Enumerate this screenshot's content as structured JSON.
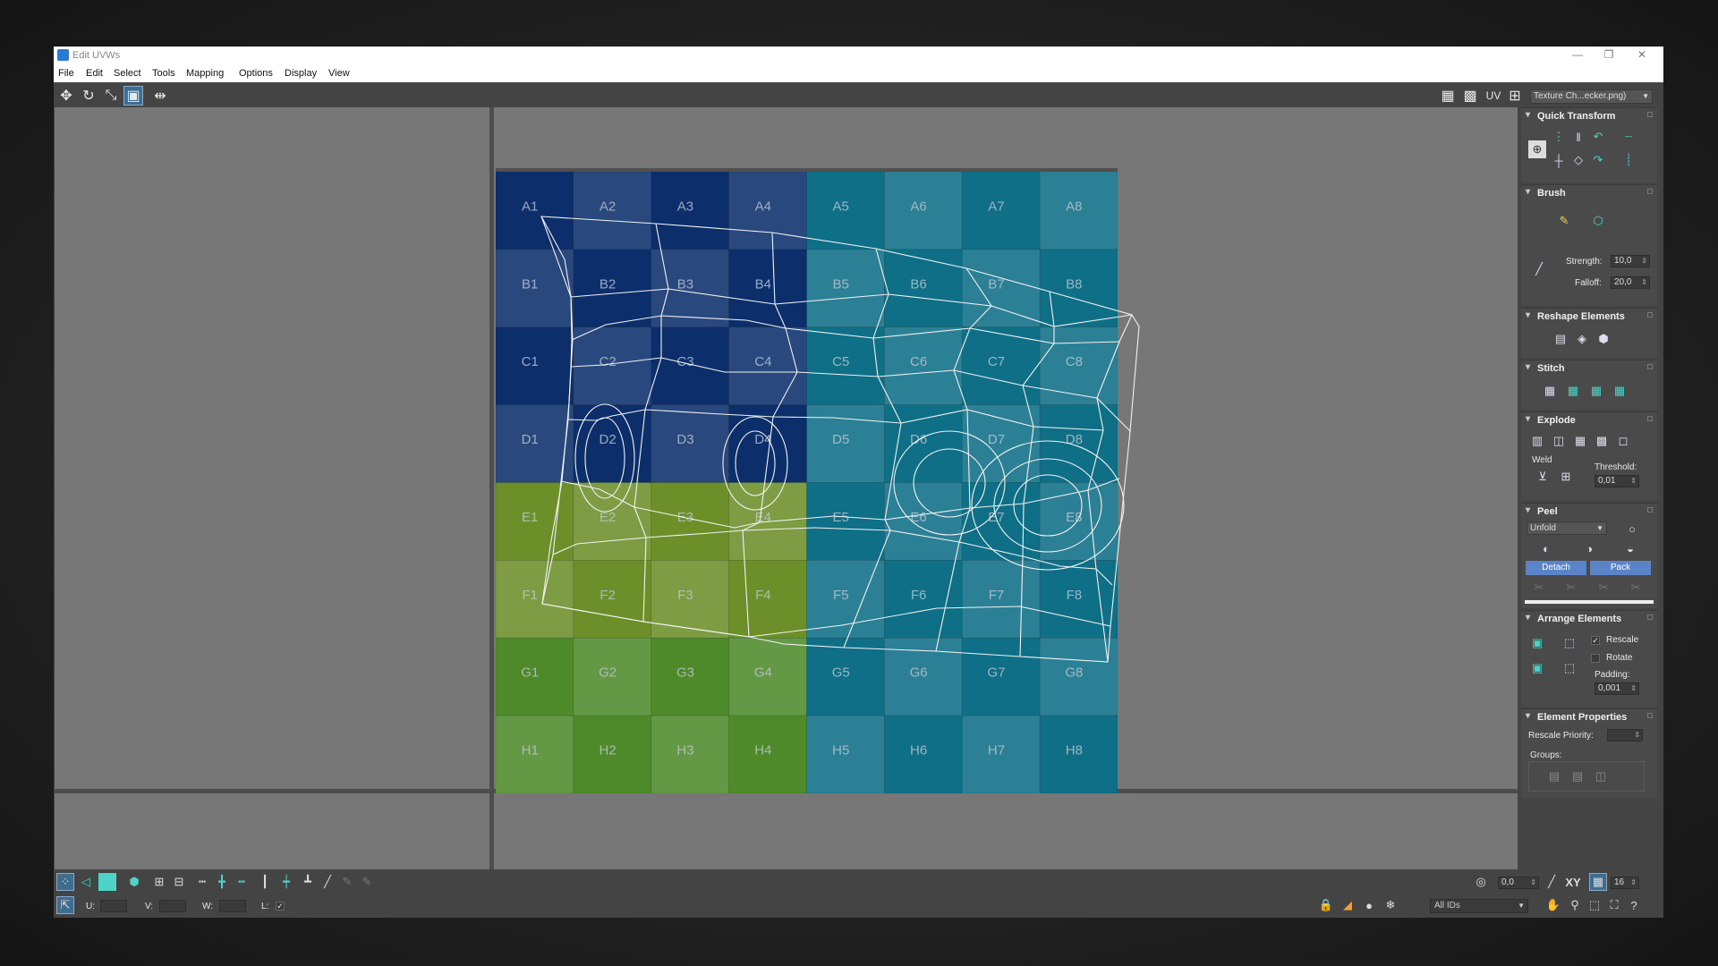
{
  "window": {
    "title": "Edit UVWs",
    "minimize": "—",
    "maximize": "❐",
    "close": "✕"
  },
  "menu": [
    "File",
    "Edit",
    "Select",
    "Tools",
    "Mapping",
    "Options",
    "Display",
    "View"
  ],
  "toolbar": {
    "uv_label": "UV",
    "texture_dropdown": "Texture Ch...ecker.png)"
  },
  "checker": {
    "rows": [
      "A",
      "B",
      "C",
      "D",
      "E",
      "F",
      "G",
      "H"
    ],
    "cols": [
      "1",
      "2",
      "3",
      "4",
      "5",
      "6",
      "7",
      "8"
    ]
  },
  "panel": {
    "quick_transform": "Quick Transform",
    "brush": "Brush",
    "strength_label": "Strength:",
    "strength_value": "10,0",
    "falloff_label": "Falloff:",
    "falloff_value": "20,0",
    "reshape": "Reshape Elements",
    "stitch": "Stitch",
    "explode": "Explode",
    "weld": "Weld",
    "threshold_label": "Threshold:",
    "threshold_value": "0,01",
    "peel": "Peel",
    "unfold": "Unfold",
    "detach": "Detach",
    "pack": "Pack",
    "arrange": "Arrange Elements",
    "rescale": "Rescale",
    "rotate": "Rotate",
    "padding_label": "Padding:",
    "padding_value": "0,001",
    "element_props": "Element Properties",
    "rescale_priority": "Rescale Priority:",
    "groups": "Groups:"
  },
  "bottom": {
    "angle_value": "0,0",
    "xy_label": "XY",
    "grid_value": "16",
    "u_label": "U:",
    "v_label": "V:",
    "w_label": "W:",
    "l_label": "L:",
    "ids_dropdown": "All IDs"
  },
  "colors": {
    "blue_dark": "#0c2f6c",
    "teal": "#0f6f86",
    "green": "#4e8a2a",
    "olive": "#6c8f2a",
    "accent": "#5b83c9"
  }
}
